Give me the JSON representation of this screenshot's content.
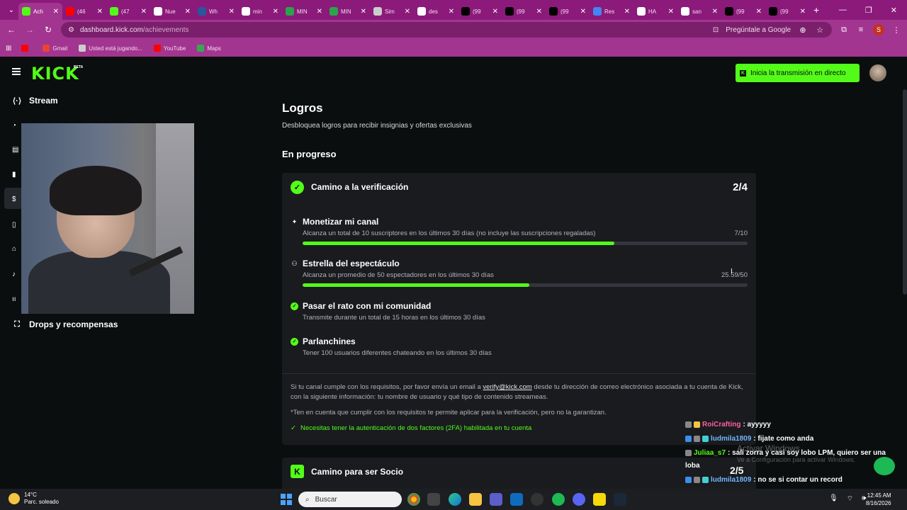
{
  "browser": {
    "tabs": [
      {
        "label": "Ach",
        "icon": "kick-favicon",
        "color": "#53fc18",
        "active": true
      },
      {
        "label": "(46",
        "icon": "youtube-favicon",
        "color": "#ff0000"
      },
      {
        "label": "(47",
        "icon": "kick-favicon",
        "color": "#53fc18"
      },
      {
        "label": "Nue",
        "icon": "notion-favicon",
        "color": "#ffffff"
      },
      {
        "label": "Wh",
        "icon": "word-favicon",
        "color": "#2b579a"
      },
      {
        "label": "min",
        "icon": "google-favicon",
        "color": "#ffffff"
      },
      {
        "label": "MIN",
        "icon": "flag-favicon",
        "color": "#2ca34a"
      },
      {
        "label": "MIN",
        "icon": "flag-favicon",
        "color": "#2ca34a"
      },
      {
        "label": "Sim",
        "icon": "site-favicon",
        "color": "#cccccc"
      },
      {
        "label": "des",
        "icon": "google-favicon",
        "color": "#ffffff"
      },
      {
        "label": "(99",
        "icon": "tiktok-favicon",
        "color": "#000000"
      },
      {
        "label": "(99",
        "icon": "tiktok-favicon",
        "color": "#000000"
      },
      {
        "label": "(99",
        "icon": "tiktok-favicon",
        "color": "#000000"
      },
      {
        "label": "Res",
        "icon": "doc-favicon",
        "color": "#4285f4"
      },
      {
        "label": "HA",
        "icon": "google-favicon",
        "color": "#ffffff"
      },
      {
        "label": "san",
        "icon": "google-favicon",
        "color": "#ffffff"
      },
      {
        "label": "(99",
        "icon": "tiktok-favicon",
        "color": "#000000"
      },
      {
        "label": "(99",
        "icon": "tiktok-favicon",
        "color": "#000000"
      }
    ],
    "url_host": "dashboard.kick.com",
    "url_path": "/achievements",
    "ask_google": "Pregúntale a Google",
    "profile_initial": "S",
    "bookmarks": [
      {
        "label": "",
        "icon": "youtube-favicon",
        "color": "#ff0000"
      },
      {
        "label": "Gmail",
        "icon": "gmail-favicon",
        "color": "#ea4335"
      },
      {
        "label": "Usted está jugando...",
        "icon": "site-favicon",
        "color": "#cccccc"
      },
      {
        "label": "YouTube",
        "icon": "youtube-favicon",
        "color": "#ff0000"
      },
      {
        "label": "Maps",
        "icon": "maps-favicon",
        "color": "#34a853"
      }
    ]
  },
  "header": {
    "logo": "KICK",
    "beta": "BETA",
    "go_live": "Inicia la transmisión en directo",
    "accent": "#53fc18"
  },
  "sidebar": {
    "stream": "Stream",
    "drops": "Drops y recompensas"
  },
  "page": {
    "title": "Logros",
    "subtitle": "Desbloquea logros para recibir insignias y ofertas exclusivas",
    "section": "En progreso"
  },
  "verification": {
    "title": "Camino a la verificación",
    "count": "2/4",
    "tasks": [
      {
        "title": "Monetizar mi canal",
        "desc": "Alcanza un total de 10 suscriptores en los últimos 30 días (no incluye las suscripciones regaladas)",
        "progress": "7/10",
        "fraction": 0.7,
        "icon": "sparkle-icon"
      },
      {
        "title": "Estrella del espectáculo",
        "desc": "Alcanza un promedio de 50 espectadores en los últimos 30 días",
        "progress": "25.59/50",
        "fraction": 0.51,
        "icon": "people-icon"
      },
      {
        "title": "Pasar el rato con mi comunidad",
        "desc": "Transmite durante un total de 15 horas en los últimos 30 días",
        "icon": "check-circle-icon"
      },
      {
        "title": "Parlanchines",
        "desc": "Tener 100 usuarios diferentes chateando en los últimos 30 días",
        "icon": "check-circle-icon"
      }
    ],
    "footer_before": "Si tu canal cumple con los requisitos, por favor envía un email a ",
    "footer_email": "verify@kick.com",
    "footer_after": " desde tu dirección de correo electrónico asociada a tu cuenta de Kick, con la siguiente información: tu nombre de usuario y qué tipo de contenido streameas.",
    "note": "*Ten en cuenta que cumplir con los requisitos te permite aplicar para la verificación, pero no la garantizan.",
    "twofa": "Necesitas tener la autenticación de dos factores (2FA) habilitada en tu cuenta"
  },
  "partner": {
    "title": "Camino para ser Socio"
  },
  "chat": {
    "messages": [
      {
        "user": "RoiCrafting",
        "text": ": ayyyyy",
        "color": "#ff5fa2"
      },
      {
        "user": "ludmila1809",
        "text": ": fijate como anda",
        "color": "#6fb8ff"
      },
      {
        "user": "Juliaa_s7",
        "text": ": sali zorra y casi soy lobo LPM, quiero ser una",
        "color": "#53fc18"
      },
      {
        "user": "",
        "text": "loba",
        "color": "#ffffff"
      },
      {
        "user": "ludmila1809",
        "text": ": no se si contar un record",
        "color": "#6fb8ff"
      }
    ],
    "watermark": "Activar Windows",
    "watermark_sub": "Ve a Configuración para activar Windows.",
    "overlay_count": "2/5"
  },
  "taskbar": {
    "temp": "14°C",
    "weather": "Parc. soleado",
    "search": "Buscar",
    "time": "12:45 AM",
    "date": "8/16/2026"
  }
}
